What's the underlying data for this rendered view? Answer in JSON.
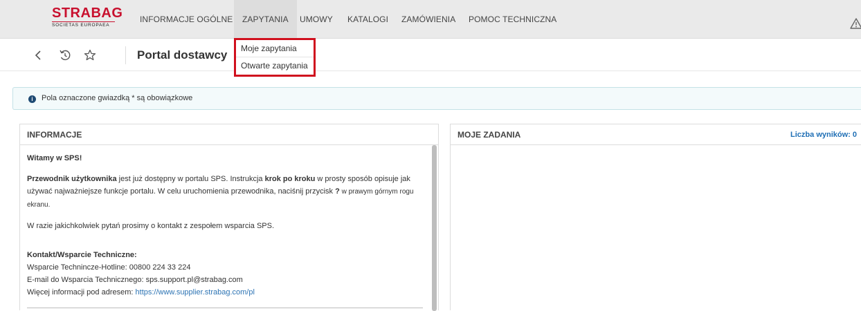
{
  "logo": {
    "brand": "STRABAG",
    "tagline": "SOCIETAS EUROPAEA"
  },
  "nav": {
    "items": [
      "INFORMACJE OGÓLNE",
      "ZAPYTANIA",
      "UMOWY",
      "KATALOGI",
      "ZAMÓWIENIA",
      "POMOC TECHNICZNA"
    ],
    "active": "ZAPYTANIA"
  },
  "subbar": {
    "title": "Portal dostawcy"
  },
  "dropdown": {
    "items": [
      "Moje zapytania",
      "Otwarte zapytania"
    ]
  },
  "notice": {
    "text": "Pola oznaczone gwiazdką * są obowiązkowe"
  },
  "info_panel": {
    "header": "INFORMACJE",
    "welcome": "Witamy w SPS!",
    "guide_bold": "Przewodnik użytkownika",
    "guide_text_1": " jest już dostępny w portalu SPS. Instrukcja ",
    "guide_bold_2": "krok po kroku",
    "guide_text_2": " w prosty sposób opisuje jak używać najważniejsze funkcje portalu. W celu uruchomienia przewodnika, naciśnij przycisk ",
    "guide_q": "?",
    "guide_text_3": " w prawym górnym rogu ekranu.",
    "contact_line": "W razie jakichkolwiek pytań prosimy o kontakt z zespołem wsparcia SPS.",
    "contact_header": "Kontakt/Wsparcie Techniczne:",
    "hotline": "Wsparcie Technincze-Hotline: 00800 224 33 224",
    "email": "E-mail do Wsparcia Technicznego: sps.support.pl@strabag.com",
    "more_prefix": "Więcej informacji pod adresem: ",
    "more_link": "https://www.supplier.strabag.com/pl"
  },
  "tasks_panel": {
    "header": "MOJE ZADANIA",
    "results": "Liczba wyników: 0"
  },
  "icons": [
    "chevron-left-icon",
    "history-icon",
    "star-icon",
    "warning-icon",
    "info-icon"
  ],
  "colors": {
    "brand_red": "#c8102e",
    "highlight": "#d0101e",
    "link": "#2d74b4",
    "info_bg": "#f3fafb"
  }
}
